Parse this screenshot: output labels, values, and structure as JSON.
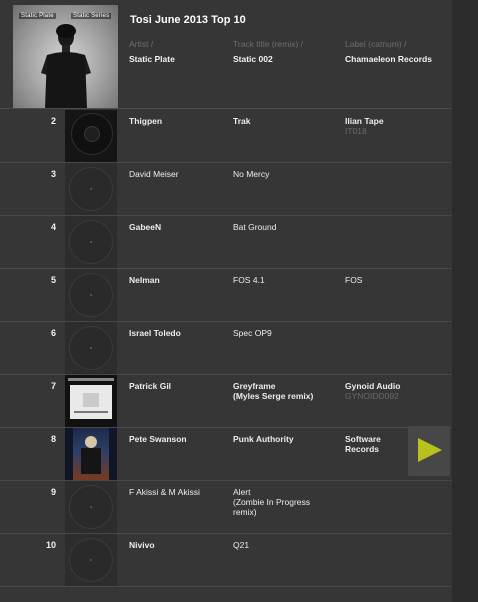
{
  "header": {
    "title": "Tosi June 2013 Top 10",
    "columns": [
      "Artist /",
      "Track title (remix) /",
      "Label (catnum) /"
    ],
    "top_entry": {
      "artist": "Static Plate",
      "track": "Static 002",
      "label": "Chamaeleon Records",
      "cover_text_left": "Static Plate",
      "cover_text_right": "Static Series"
    }
  },
  "rows": [
    {
      "rank": "2",
      "artist": "Thigpen",
      "track": "Trak",
      "label": "Ilian Tape",
      "catnum": "IT018",
      "thumb": "dark-label-art"
    },
    {
      "rank": "3",
      "artist": "David Meiser",
      "track": "No Mercy",
      "label": "",
      "catnum": "",
      "thumb": "placeholder-disc"
    },
    {
      "rank": "4",
      "artist": "GabeeN",
      "track": "Bat Ground",
      "label": "",
      "catnum": "",
      "thumb": "placeholder-disc"
    },
    {
      "rank": "5",
      "artist": "Nelman",
      "track": "FOS 4.1",
      "label": "FOS",
      "catnum": "",
      "thumb": "placeholder-disc"
    },
    {
      "rank": "6",
      "artist": "Israel Toledo",
      "track": "Spec OP9",
      "label": "",
      "catnum": "",
      "thumb": "placeholder-disc"
    },
    {
      "rank": "7",
      "artist": "Patrick Gil",
      "track": "Greyframe (Myles Serge remix)",
      "track_line1": "Greyframe",
      "track_line2": "(Myles Serge remix)",
      "label": "Gynoid Audio",
      "catnum": "GYNOIDD092",
      "thumb": "greyframe-art"
    },
    {
      "rank": "8",
      "artist": "Pete Swanson",
      "track": "Punk Authority",
      "label": "Software Records",
      "label_line1": "Software",
      "label_line2": "Records",
      "catnum": "",
      "thumb": "punk-authority-art"
    },
    {
      "rank": "9",
      "artist": "F Akissi & M Akissi",
      "track": "Alert (Zombie In Progress remix)",
      "track_line1": "Alert",
      "track_line2": "(Zombie In Progress",
      "track_line3": "remix)",
      "label": "",
      "catnum": "",
      "thumb": "placeholder-disc"
    },
    {
      "rank": "10",
      "artist": "Nivivo",
      "track": "Q21",
      "label": "",
      "catnum": "",
      "thumb": "placeholder-disc"
    }
  ],
  "player": {
    "icon": "play-icon",
    "accent": "#b8c21a"
  }
}
